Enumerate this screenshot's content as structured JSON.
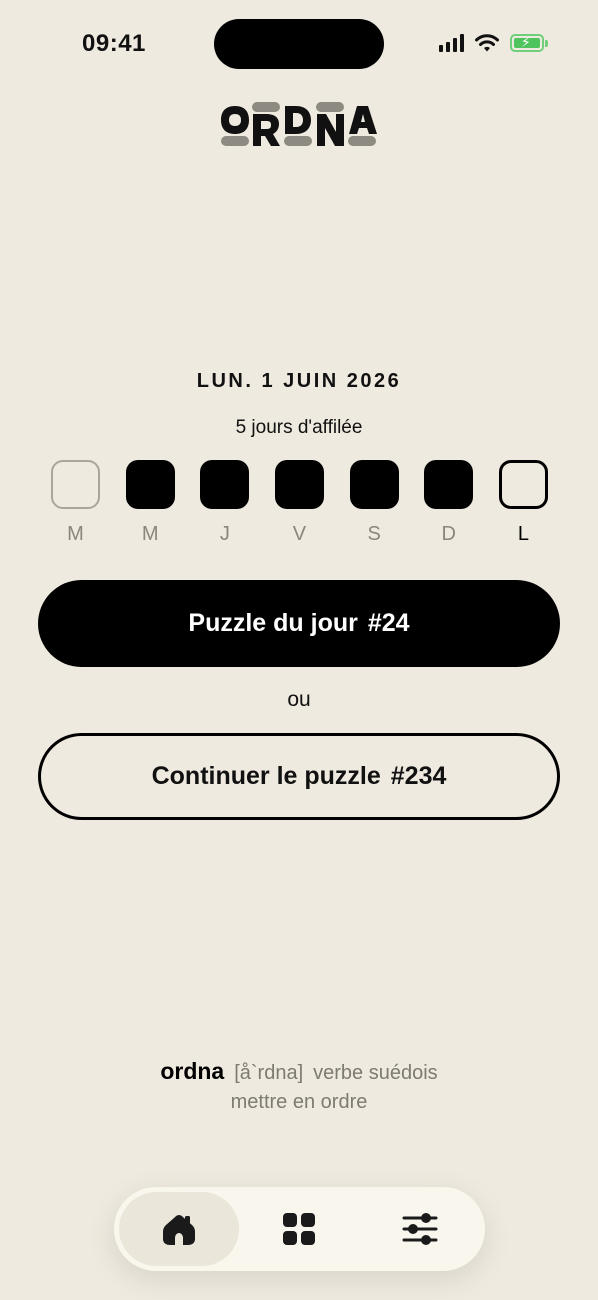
{
  "status_bar": {
    "time": "09:41",
    "icons": [
      "signal-icon",
      "wifi-icon",
      "battery-charging-icon"
    ]
  },
  "logo": {
    "text": "ORDNA",
    "letters": [
      "O",
      "R",
      "D",
      "N",
      "A"
    ]
  },
  "date": "LUN. 1 JUIN 2026",
  "streak_text": "5 jours d'affilée",
  "week": [
    {
      "label": "M",
      "state": "empty"
    },
    {
      "label": "M",
      "state": "done"
    },
    {
      "label": "J",
      "state": "done"
    },
    {
      "label": "V",
      "state": "done"
    },
    {
      "label": "S",
      "state": "done"
    },
    {
      "label": "D",
      "state": "done"
    },
    {
      "label": "L",
      "state": "today"
    }
  ],
  "primary_button": {
    "label": "Puzzle du jour",
    "number": "#24"
  },
  "or_text": "ou",
  "secondary_button": {
    "label": "Continuer le puzzle",
    "number": "#234"
  },
  "definition": {
    "word": "ordna",
    "phonetic": "[å`rdna]",
    "grammar": "verbe suédois",
    "meaning": "mettre en ordre"
  },
  "nav": [
    {
      "name": "home",
      "icon": "home-icon",
      "active": true
    },
    {
      "name": "archive",
      "icon": "grid-icon",
      "active": false
    },
    {
      "name": "settings",
      "icon": "sliders-icon",
      "active": false
    }
  ],
  "colors": {
    "background": "#efeadf",
    "text": "#000000",
    "muted": "#8a867d",
    "nav_background": "#f9f6ee",
    "battery": "#4fc45d"
  }
}
